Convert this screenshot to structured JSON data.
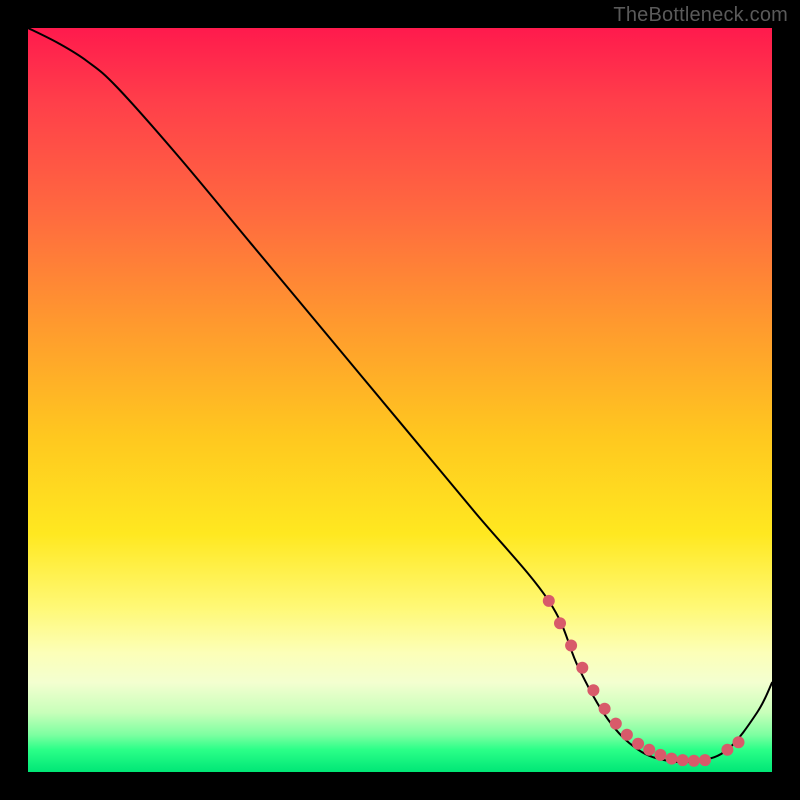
{
  "watermark": "TheBottleneck.com",
  "chart_data": {
    "type": "line",
    "title": "",
    "xlabel": "",
    "ylabel": "",
    "xlim": [
      0,
      100
    ],
    "ylim": [
      0,
      100
    ],
    "series": [
      {
        "name": "curve",
        "x": [
          0,
          4,
          8,
          12,
          20,
          30,
          40,
          50,
          60,
          70,
          74,
          78,
          82,
          86,
          90,
          94,
          98,
          100
        ],
        "y": [
          100,
          98,
          95.5,
          92,
          83,
          71,
          59,
          47,
          35,
          23,
          14,
          7,
          3,
          1.5,
          1.5,
          3,
          8,
          12
        ]
      }
    ],
    "markers": {
      "name": "highlight-dots",
      "color": "#d85a6a",
      "x": [
        70,
        71.5,
        73,
        74.5,
        76,
        77.5,
        79,
        80.5,
        82,
        83.5,
        85,
        86.5,
        88,
        89.5,
        91,
        94,
        95.5
      ],
      "y": [
        23,
        20,
        17,
        14,
        11,
        8.5,
        6.5,
        5,
        3.8,
        3,
        2.3,
        1.8,
        1.6,
        1.5,
        1.6,
        3,
        4
      ]
    }
  }
}
